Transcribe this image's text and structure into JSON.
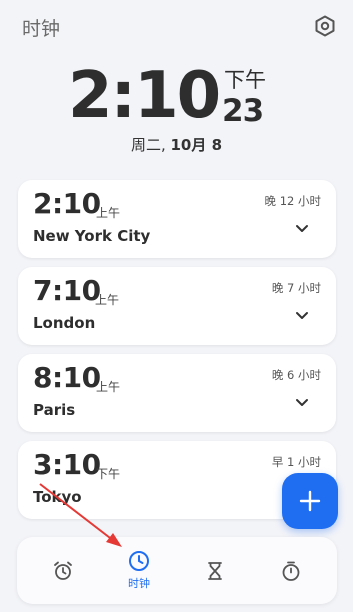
{
  "header": {
    "title": "时钟",
    "settings_icon": "settings-hexagon-icon"
  },
  "main_clock": {
    "time": "2:10",
    "ampm": "下午",
    "seconds": "23",
    "date_weekday": "周二, ",
    "date_month": "10月",
    "date_day": " 8"
  },
  "world_clocks": [
    {
      "time": "2:10",
      "ampm": "上午",
      "city": "New York City",
      "offset": "晚 12 小时"
    },
    {
      "time": "7:10",
      "ampm": "上午",
      "city": "London",
      "offset": "晚 7 小时"
    },
    {
      "time": "8:10",
      "ampm": "上午",
      "city": "Paris",
      "offset": "晚 6 小时"
    },
    {
      "time": "3:10",
      "ampm": "下午",
      "city": "Tokyo",
      "offset": "早 1 小时"
    }
  ],
  "fab": {
    "icon": "plus-icon"
  },
  "bottom_nav": {
    "items": [
      {
        "icon": "alarm-icon",
        "label": ""
      },
      {
        "icon": "clock-icon",
        "label": "时钟",
        "active": true
      },
      {
        "icon": "hourglass-icon",
        "label": ""
      },
      {
        "icon": "stopwatch-icon",
        "label": ""
      }
    ]
  },
  "colors": {
    "accent": "#1f6ef2",
    "background": "#f3f4f8",
    "card": "#ffffff",
    "annotation": "#e53935"
  }
}
